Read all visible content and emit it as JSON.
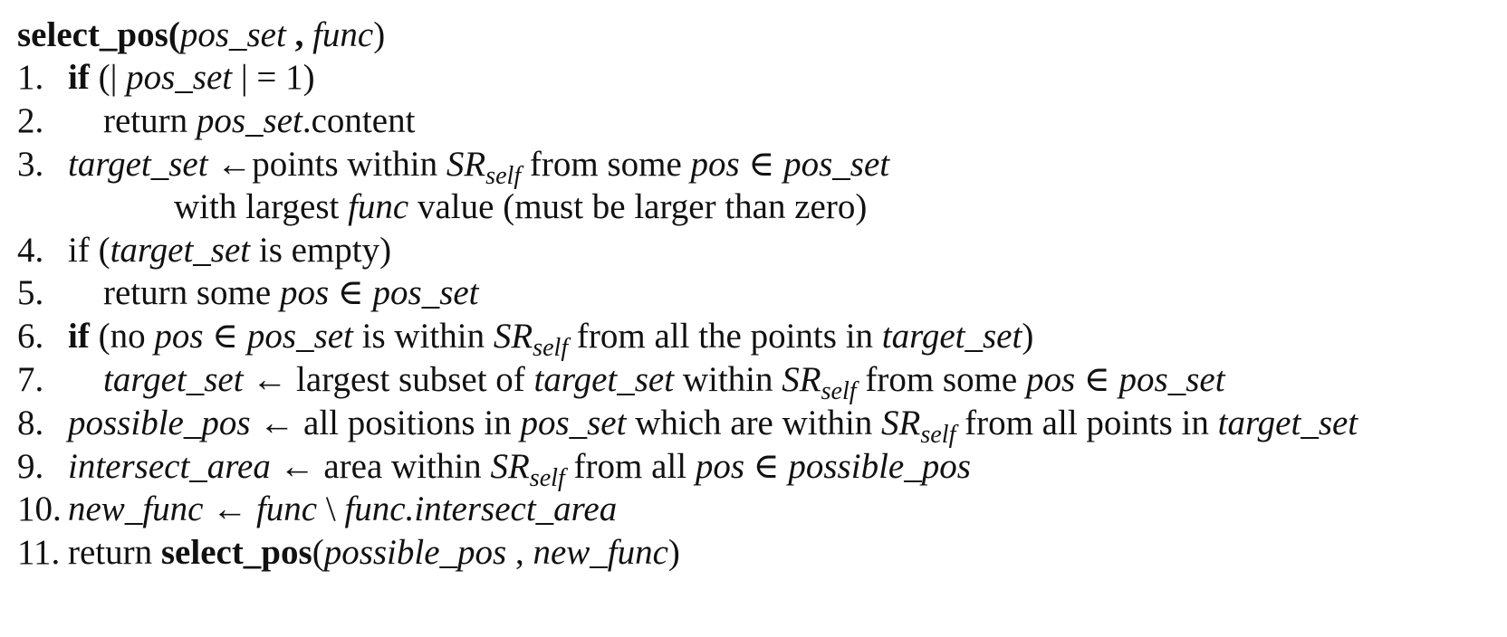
{
  "algorithm": {
    "header": {
      "fn_name": "select_pos",
      "open_paren": "(",
      "arg1": "pos_set",
      "comma": " , ",
      "arg2": "func",
      "close_paren": ")"
    },
    "lines": [
      {
        "num": "1.",
        "segments": [
          {
            "t": "if",
            "s": "b"
          },
          {
            "t": " (| ",
            "s": "n"
          },
          {
            "t": "pos_set",
            "s": "m"
          },
          {
            "t": " | = 1)",
            "s": "n"
          }
        ]
      },
      {
        "num": "2.",
        "segments": [
          {
            "t": "return ",
            "s": "n"
          },
          {
            "t": "pos_set",
            "s": "m"
          },
          {
            "t": ".content",
            "s": "n"
          }
        ]
      },
      {
        "num": "3.",
        "segments": [
          {
            "t": "target_set",
            "s": "m"
          },
          {
            "t": " ←points within ",
            "s": "n"
          },
          {
            "t": "SR",
            "s": "m"
          },
          {
            "t": "self",
            "s": "sub"
          },
          {
            "t": " from some ",
            "s": "n"
          },
          {
            "t": "pos",
            "s": "m"
          },
          {
            "t": " ∈ ",
            "s": "n"
          },
          {
            "t": "pos_set",
            "s": "m"
          }
        ]
      },
      {
        "num": "",
        "segments": [
          {
            "t": "with largest ",
            "s": "n"
          },
          {
            "t": "func",
            "s": "m"
          },
          {
            "t": " value (must be larger than zero)",
            "s": "n"
          }
        ]
      },
      {
        "num": "4.",
        "segments": [
          {
            "t": "if (",
            "s": "n"
          },
          {
            "t": "target_set",
            "s": "m"
          },
          {
            "t": " is empty)",
            "s": "n"
          }
        ]
      },
      {
        "num": "5.",
        "segments": [
          {
            "t": "return some ",
            "s": "n"
          },
          {
            "t": "pos",
            "s": "m"
          },
          {
            "t": " ∈ ",
            "s": "n"
          },
          {
            "t": "pos_set",
            "s": "m"
          }
        ]
      },
      {
        "num": "6.",
        "segments": [
          {
            "t": "if",
            "s": "b"
          },
          {
            "t": " (no ",
            "s": "n"
          },
          {
            "t": "pos",
            "s": "m"
          },
          {
            "t": " ∈ ",
            "s": "n"
          },
          {
            "t": "pos_set",
            "s": "m"
          },
          {
            "t": " is within ",
            "s": "n"
          },
          {
            "t": "SR",
            "s": "m"
          },
          {
            "t": "self",
            "s": "sub"
          },
          {
            "t": " from all the points in ",
            "s": "n"
          },
          {
            "t": "target_set",
            "s": "m"
          },
          {
            "t": ")",
            "s": "n"
          }
        ]
      },
      {
        "num": "7.",
        "segments": [
          {
            "t": "target_set",
            "s": "m"
          },
          {
            "t": " ← largest subset of ",
            "s": "n"
          },
          {
            "t": "target_set",
            "s": "m"
          },
          {
            "t": " within ",
            "s": "n"
          },
          {
            "t": "SR",
            "s": "m"
          },
          {
            "t": "self",
            "s": "sub"
          },
          {
            "t": " from some ",
            "s": "n"
          },
          {
            "t": "pos",
            "s": "m"
          },
          {
            "t": " ∈ ",
            "s": "n"
          },
          {
            "t": "pos_set",
            "s": "m"
          }
        ]
      },
      {
        "num": "8.",
        "segments": [
          {
            "t": "possible_pos",
            "s": "m"
          },
          {
            "t": " ← all positions in ",
            "s": "n"
          },
          {
            "t": "pos_set",
            "s": "m"
          },
          {
            "t": " which are within ",
            "s": "n"
          },
          {
            "t": "SR",
            "s": "m"
          },
          {
            "t": "self",
            "s": "sub"
          },
          {
            "t": " from all points in ",
            "s": "n"
          },
          {
            "t": "target_set",
            "s": "m"
          }
        ]
      },
      {
        "num": "9.",
        "segments": [
          {
            "t": "intersect_area",
            "s": "m"
          },
          {
            "t": " ← area within ",
            "s": "n"
          },
          {
            "t": "SR",
            "s": "m"
          },
          {
            "t": "self",
            "s": "sub"
          },
          {
            "t": " from all ",
            "s": "n"
          },
          {
            "t": "pos",
            "s": "m"
          },
          {
            "t": " ∈ ",
            "s": "n"
          },
          {
            "t": "possible_pos",
            "s": "m"
          }
        ]
      },
      {
        "num": "10.",
        "segments": [
          {
            "t": "new_func",
            "s": "m"
          },
          {
            "t": " ← ",
            "s": "n"
          },
          {
            "t": "func",
            "s": "m"
          },
          {
            "t": " \\ ",
            "s": "n"
          },
          {
            "t": "func.intersect_area",
            "s": "m"
          }
        ]
      },
      {
        "num": "11.",
        "segments": [
          {
            "t": "return ",
            "s": "n"
          },
          {
            "t": "select_pos",
            "s": "b"
          },
          {
            "t": "(",
            "s": "n"
          },
          {
            "t": "possible_pos",
            "s": "m"
          },
          {
            "t": " , ",
            "s": "n"
          },
          {
            "t": "new_func",
            "s": "m"
          },
          {
            "t": ")",
            "s": "n"
          }
        ]
      }
    ]
  }
}
